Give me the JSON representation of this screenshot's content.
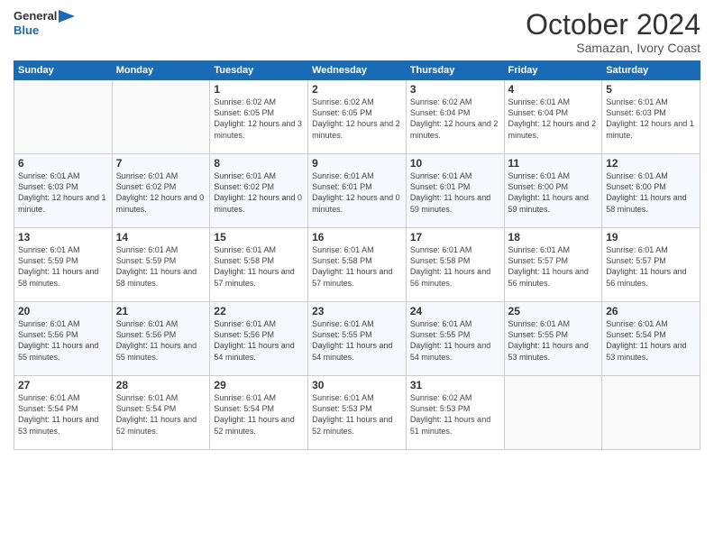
{
  "header": {
    "logo_line1": "General",
    "logo_line2": "Blue",
    "month": "October 2024",
    "location": "Samazan, Ivory Coast"
  },
  "weekdays": [
    "Sunday",
    "Monday",
    "Tuesday",
    "Wednesday",
    "Thursday",
    "Friday",
    "Saturday"
  ],
  "weeks": [
    [
      {
        "day": "",
        "info": ""
      },
      {
        "day": "",
        "info": ""
      },
      {
        "day": "1",
        "info": "Sunrise: 6:02 AM\nSunset: 6:05 PM\nDaylight: 12 hours and 3 minutes."
      },
      {
        "day": "2",
        "info": "Sunrise: 6:02 AM\nSunset: 6:05 PM\nDaylight: 12 hours and 2 minutes."
      },
      {
        "day": "3",
        "info": "Sunrise: 6:02 AM\nSunset: 6:04 PM\nDaylight: 12 hours and 2 minutes."
      },
      {
        "day": "4",
        "info": "Sunrise: 6:01 AM\nSunset: 6:04 PM\nDaylight: 12 hours and 2 minutes."
      },
      {
        "day": "5",
        "info": "Sunrise: 6:01 AM\nSunset: 6:03 PM\nDaylight: 12 hours and 1 minute."
      }
    ],
    [
      {
        "day": "6",
        "info": "Sunrise: 6:01 AM\nSunset: 6:03 PM\nDaylight: 12 hours and 1 minute."
      },
      {
        "day": "7",
        "info": "Sunrise: 6:01 AM\nSunset: 6:02 PM\nDaylight: 12 hours and 0 minutes."
      },
      {
        "day": "8",
        "info": "Sunrise: 6:01 AM\nSunset: 6:02 PM\nDaylight: 12 hours and 0 minutes."
      },
      {
        "day": "9",
        "info": "Sunrise: 6:01 AM\nSunset: 6:01 PM\nDaylight: 12 hours and 0 minutes."
      },
      {
        "day": "10",
        "info": "Sunrise: 6:01 AM\nSunset: 6:01 PM\nDaylight: 11 hours and 59 minutes."
      },
      {
        "day": "11",
        "info": "Sunrise: 6:01 AM\nSunset: 6:00 PM\nDaylight: 11 hours and 59 minutes."
      },
      {
        "day": "12",
        "info": "Sunrise: 6:01 AM\nSunset: 6:00 PM\nDaylight: 11 hours and 58 minutes."
      }
    ],
    [
      {
        "day": "13",
        "info": "Sunrise: 6:01 AM\nSunset: 5:59 PM\nDaylight: 11 hours and 58 minutes."
      },
      {
        "day": "14",
        "info": "Sunrise: 6:01 AM\nSunset: 5:59 PM\nDaylight: 11 hours and 58 minutes."
      },
      {
        "day": "15",
        "info": "Sunrise: 6:01 AM\nSunset: 5:58 PM\nDaylight: 11 hours and 57 minutes."
      },
      {
        "day": "16",
        "info": "Sunrise: 6:01 AM\nSunset: 5:58 PM\nDaylight: 11 hours and 57 minutes."
      },
      {
        "day": "17",
        "info": "Sunrise: 6:01 AM\nSunset: 5:58 PM\nDaylight: 11 hours and 56 minutes."
      },
      {
        "day": "18",
        "info": "Sunrise: 6:01 AM\nSunset: 5:57 PM\nDaylight: 11 hours and 56 minutes."
      },
      {
        "day": "19",
        "info": "Sunrise: 6:01 AM\nSunset: 5:57 PM\nDaylight: 11 hours and 56 minutes."
      }
    ],
    [
      {
        "day": "20",
        "info": "Sunrise: 6:01 AM\nSunset: 5:56 PM\nDaylight: 11 hours and 55 minutes."
      },
      {
        "day": "21",
        "info": "Sunrise: 6:01 AM\nSunset: 5:56 PM\nDaylight: 11 hours and 55 minutes."
      },
      {
        "day": "22",
        "info": "Sunrise: 6:01 AM\nSunset: 5:56 PM\nDaylight: 11 hours and 54 minutes."
      },
      {
        "day": "23",
        "info": "Sunrise: 6:01 AM\nSunset: 5:55 PM\nDaylight: 11 hours and 54 minutes."
      },
      {
        "day": "24",
        "info": "Sunrise: 6:01 AM\nSunset: 5:55 PM\nDaylight: 11 hours and 54 minutes."
      },
      {
        "day": "25",
        "info": "Sunrise: 6:01 AM\nSunset: 5:55 PM\nDaylight: 11 hours and 53 minutes."
      },
      {
        "day": "26",
        "info": "Sunrise: 6:01 AM\nSunset: 5:54 PM\nDaylight: 11 hours and 53 minutes."
      }
    ],
    [
      {
        "day": "27",
        "info": "Sunrise: 6:01 AM\nSunset: 5:54 PM\nDaylight: 11 hours and 53 minutes."
      },
      {
        "day": "28",
        "info": "Sunrise: 6:01 AM\nSunset: 5:54 PM\nDaylight: 11 hours and 52 minutes."
      },
      {
        "day": "29",
        "info": "Sunrise: 6:01 AM\nSunset: 5:54 PM\nDaylight: 11 hours and 52 minutes."
      },
      {
        "day": "30",
        "info": "Sunrise: 6:01 AM\nSunset: 5:53 PM\nDaylight: 11 hours and 52 minutes."
      },
      {
        "day": "31",
        "info": "Sunrise: 6:02 AM\nSunset: 5:53 PM\nDaylight: 11 hours and 51 minutes."
      },
      {
        "day": "",
        "info": ""
      },
      {
        "day": "",
        "info": ""
      }
    ]
  ]
}
